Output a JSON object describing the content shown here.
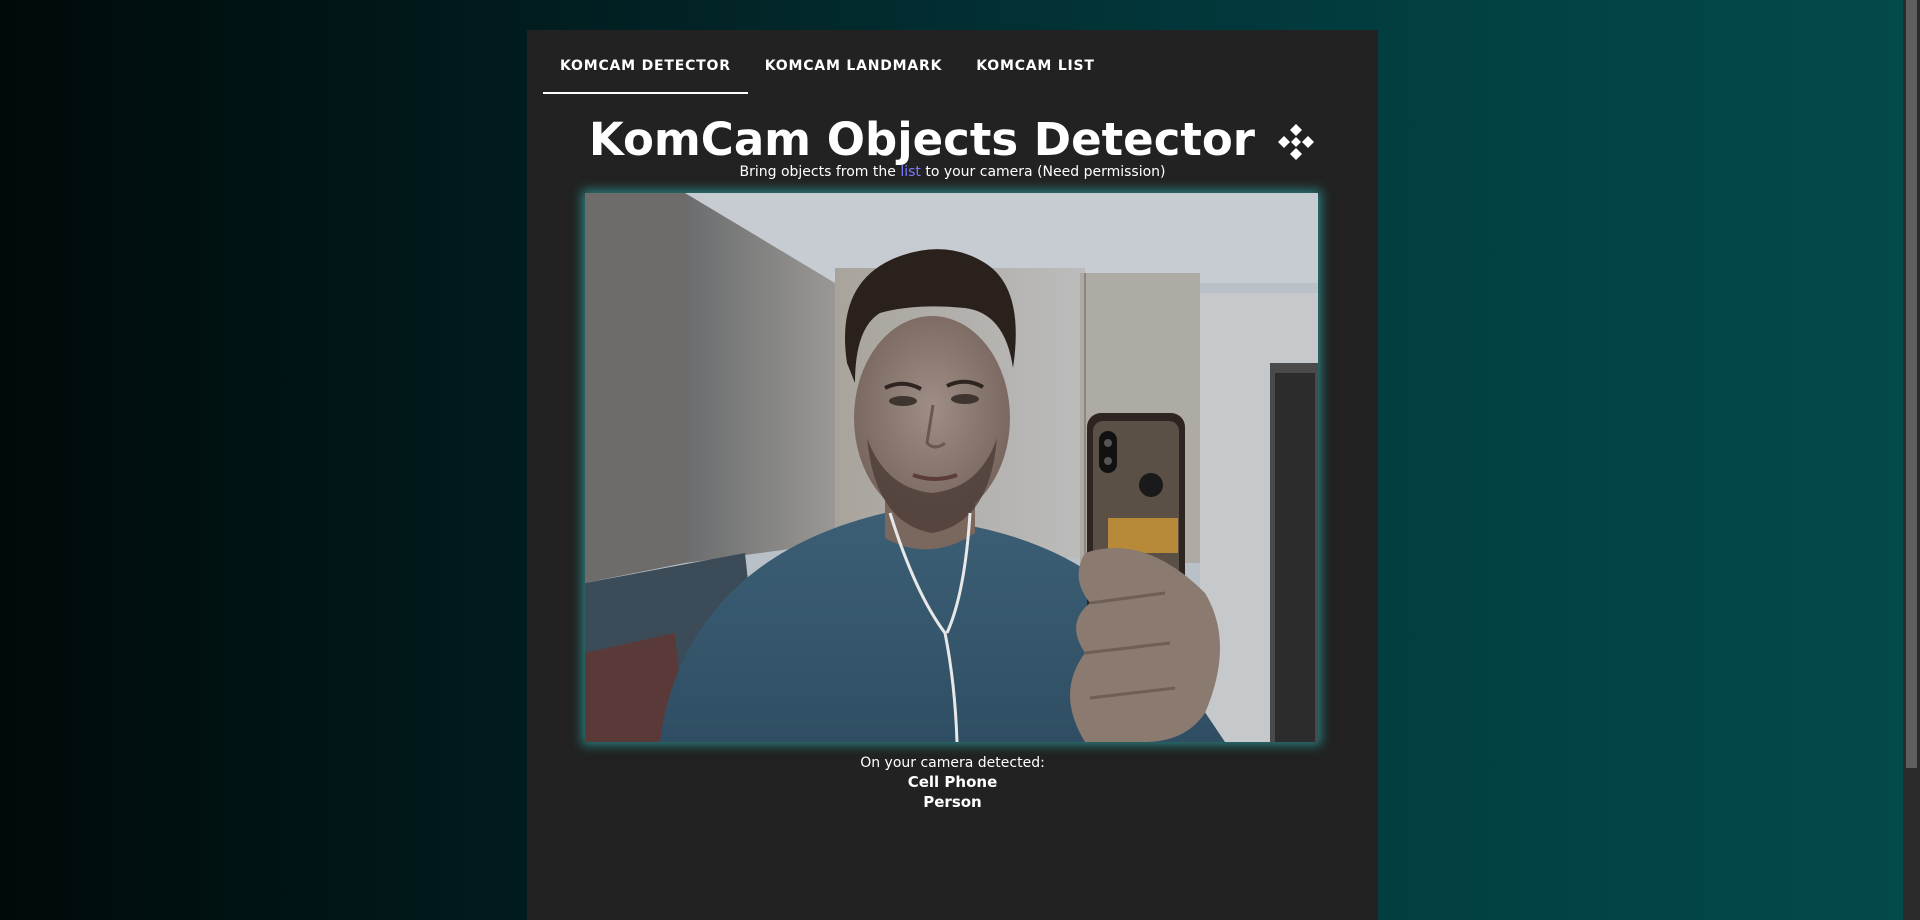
{
  "tabs": [
    {
      "label": "KOMCAM DETECTOR",
      "active": true
    },
    {
      "label": "KOMCAM LANDMARK",
      "active": false
    },
    {
      "label": "KOMCAM LIST",
      "active": false
    }
  ],
  "header": {
    "title": "KomCam Objects Detector",
    "logo_icon": "komcam-diamond-logo-icon"
  },
  "subtitle": {
    "before": "Bring objects from the ",
    "link": "list",
    "after": " to your camera (Need permission)"
  },
  "camera": {
    "description_icon": "webcam-feed"
  },
  "detection": {
    "label": "On your camera detected:",
    "items": [
      "Cell Phone",
      "Person"
    ]
  },
  "colors": {
    "panel": "#222222",
    "link": "#7b7bff",
    "glow": "#30c8c8"
  }
}
